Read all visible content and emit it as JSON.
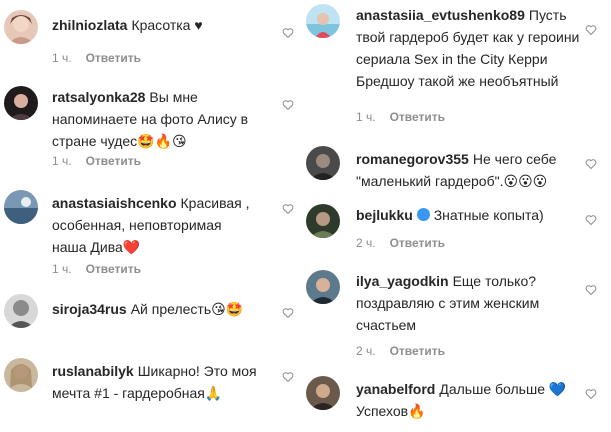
{
  "left_comments": [
    {
      "username": "zhilniozlata",
      "text": "Красотка ♥",
      "time": "1 ч.",
      "reply": "Ответить"
    },
    {
      "username": "ratsalyonka28",
      "text": "Вы мне напоминаете на фото Алису в стране чудес🤩🔥😘",
      "time": "1 ч.",
      "reply": "Ответить"
    },
    {
      "username": "anastasiaishcenko",
      "text": "Красивая , особенная, неповторимая наша Дива❤️",
      "time": "1 ч.",
      "reply": "Ответить"
    },
    {
      "username": "siroja34rus",
      "text": "Ай прелесть😘🤩",
      "time": "",
      "reply": ""
    },
    {
      "username": "ruslanabilyk",
      "text": "Шикарно! Это моя мечта #1 - гардеробная🙏",
      "time": "",
      "reply": ""
    }
  ],
  "right_comments": [
    {
      "username": "anastasiia_evtushenko89",
      "text": "Пусть твой гардероб будет как у героини сериала Sex in the City Керри Бредшоу такой же необъятный",
      "time": "1 ч.",
      "reply": "Ответить"
    },
    {
      "username": "romanegorov355",
      "text": "Не чего себе \"маленький гардероб\".😮😮😮",
      "time": "",
      "reply": ""
    },
    {
      "username": "bejlukku",
      "text": "Знатные копыта)",
      "time": "2 ч.",
      "reply": "Ответить"
    },
    {
      "username": "ilya_yagodkin",
      "text": "Еще только? поздравляю с этим женским счастьем",
      "time": "2 ч.",
      "reply": "Ответить"
    },
    {
      "username": "yanabelford",
      "text": "Дальше больше 💙 Успехов🔥",
      "time": "",
      "reply": ""
    }
  ],
  "icons": {
    "like": "heart-outline-icon",
    "verified": "verified-badge-icon"
  },
  "colors": {
    "username": "#262626",
    "meta": "#8e8e8e",
    "verified": "#3897f0"
  }
}
